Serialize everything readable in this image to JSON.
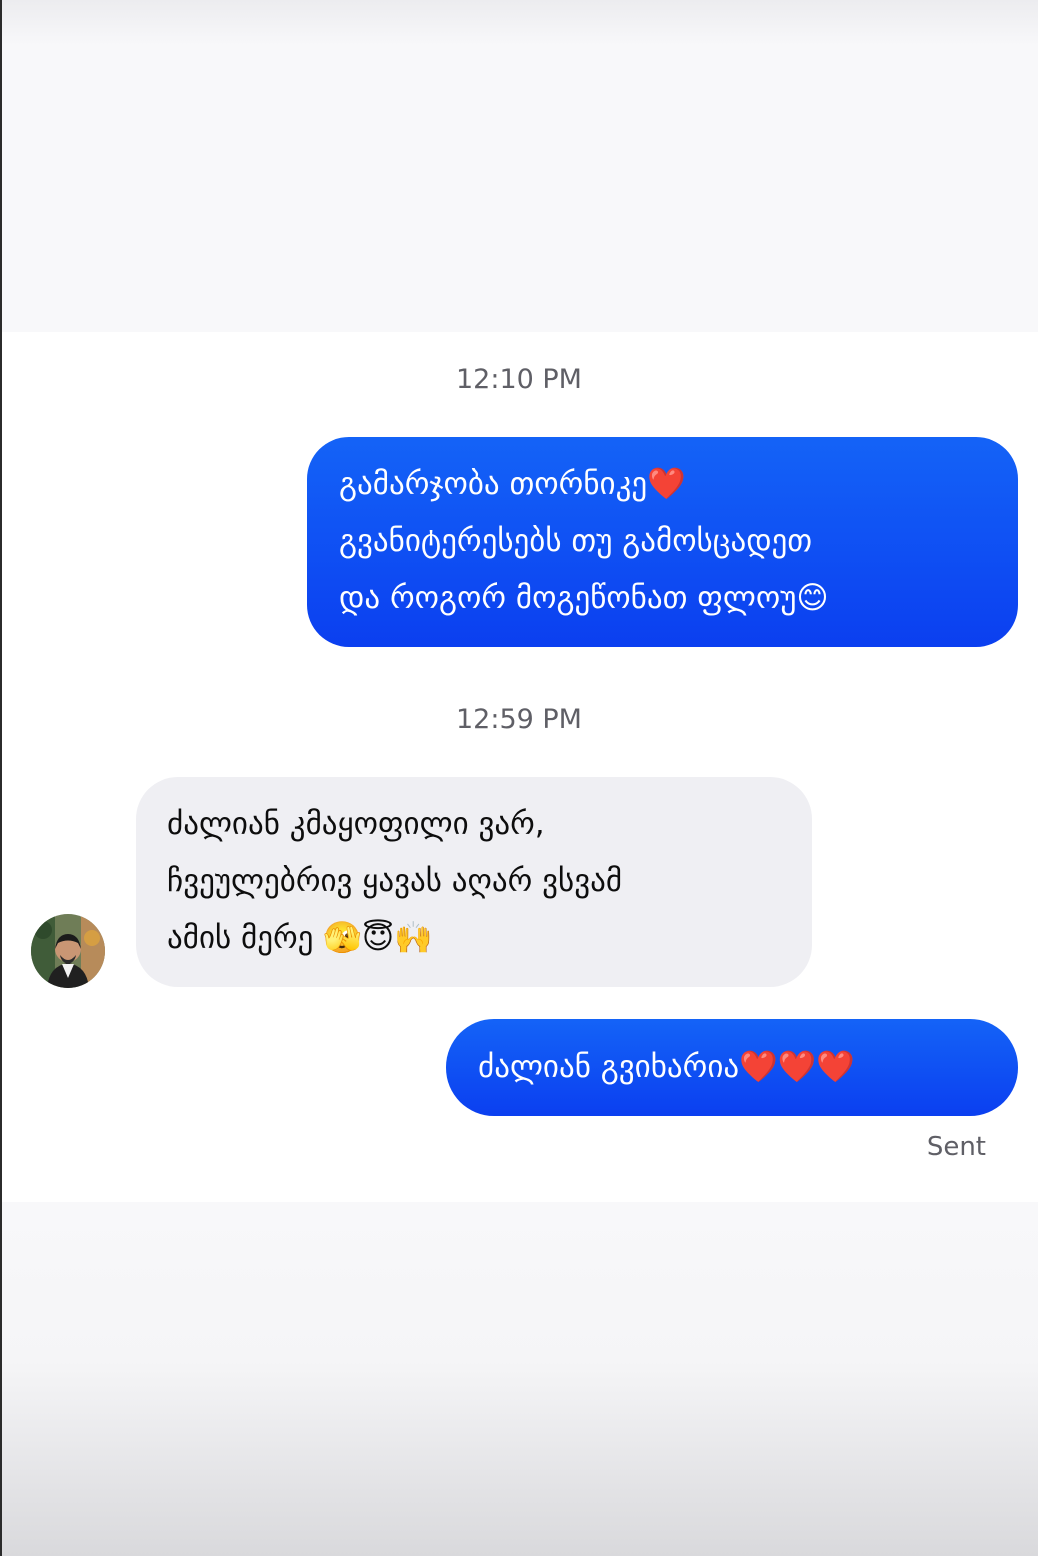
{
  "conversation": {
    "timestamp_1": "12:10 PM",
    "timestamp_2": "12:59 PM",
    "messages": [
      {
        "direction": "outgoing",
        "lines": [
          "გამარჯობა თორნიკე❤️",
          "გვანიტერესებს თუ გამოსცადეთ",
          "და როგორ მოგეწონათ ფლოუ😊"
        ]
      },
      {
        "direction": "incoming",
        "lines": [
          "ძალიან კმაყოფილი ვარ,",
          "ჩვეულებრივ ყავას აღარ ვსვამ",
          "ამის მერე 🫣😇🙌"
        ]
      },
      {
        "direction": "outgoing",
        "lines": [
          "ძალიან გვიხარია❤️❤️❤️"
        ]
      }
    ],
    "status": "Sent",
    "avatar_icon": "contact-avatar"
  },
  "colors": {
    "outgoing_bubble": "#1463f7",
    "incoming_bubble": "#efeff3",
    "timestamp_text": "#5f5f66",
    "background": "#ffffff"
  }
}
